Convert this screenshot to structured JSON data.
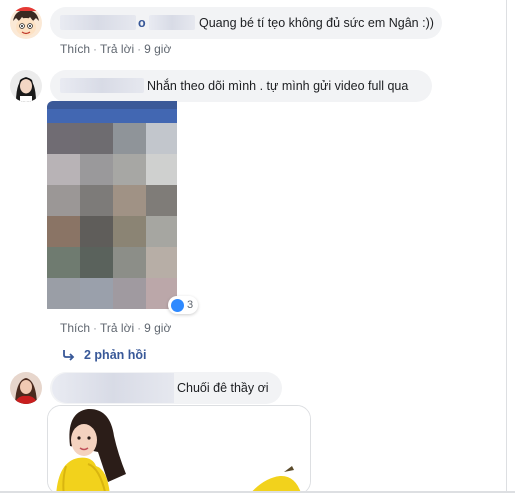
{
  "comments": [
    {
      "text": "Quang bé tí tẹo không đủ sức em Ngân :))",
      "name_fragment": "o",
      "meta": {
        "like": "Thích",
        "reply": "Trả lời",
        "time": "9 giờ"
      }
    },
    {
      "text": "Nhắn theo dõi mình . tự mình gửi video full qua",
      "meta": {
        "like": "Thích",
        "reply": "Trả lời",
        "time": "9 giờ"
      },
      "reaction_count": "3"
    },
    {
      "text": "Chuối đê thầy ơi",
      "replies_label": "2 phản hồi"
    }
  ],
  "colors": {
    "bubble": "#f2f3f5",
    "meta_text": "#606770",
    "link_blue": "#385898",
    "like_blue": "#2e89ff",
    "banana_yellow": "#f2d21c"
  },
  "icons": [
    "reply-arrow-icon",
    "like-reaction-icon",
    "kid-cartoon-avatar",
    "woman-avatar"
  ]
}
